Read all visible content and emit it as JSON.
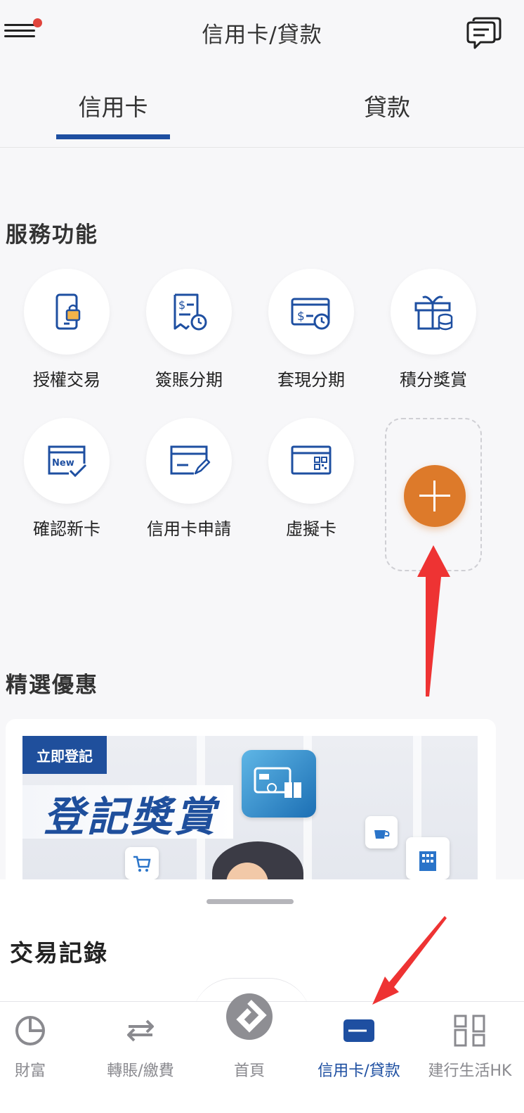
{
  "header": {
    "title": "信用卡/貸款",
    "menu_icon": "hamburger-menu-icon",
    "notification_dot_color": "#e0443c",
    "chat_icon": "chat-bubbles-icon"
  },
  "tabs": [
    {
      "label": "信用卡",
      "active": true
    },
    {
      "label": "貸款",
      "active": false
    }
  ],
  "services": {
    "title": "服務功能",
    "items": [
      {
        "label": "授權交易",
        "icon": "phone-lock-icon"
      },
      {
        "label": "簽賬分期",
        "icon": "receipt-clock-icon"
      },
      {
        "label": "套現分期",
        "icon": "cash-clock-icon"
      },
      {
        "label": "積分獎賞",
        "icon": "gift-coins-icon"
      },
      {
        "label": "確認新卡",
        "icon": "new-card-check-icon"
      },
      {
        "label": "信用卡申請",
        "icon": "card-pen-icon"
      },
      {
        "label": "虛擬卡",
        "icon": "card-qr-icon"
      }
    ],
    "add_icon": "plus-icon",
    "add_color": "#dd7a2a"
  },
  "promotions": {
    "title": "精選優惠",
    "banner": {
      "tag": "立即登記",
      "headline": "登記獎賞"
    }
  },
  "transactions": {
    "title": "交易記錄"
  },
  "bottom_nav": [
    {
      "label": "財富",
      "icon": "pie-chart-icon",
      "active": false
    },
    {
      "label": "轉賬/繳費",
      "icon": "transfer-arrows-icon",
      "active": false
    },
    {
      "label": "首頁",
      "icon": "bank-logo-icon",
      "active": false
    },
    {
      "label": "信用卡/貸款",
      "icon": "credit-card-icon",
      "active": true
    },
    {
      "label": "建行生活HK",
      "icon": "grid-apps-icon",
      "active": false
    }
  ],
  "colors": {
    "accent": "#1e4fa1",
    "arrow": "#ee3333"
  }
}
